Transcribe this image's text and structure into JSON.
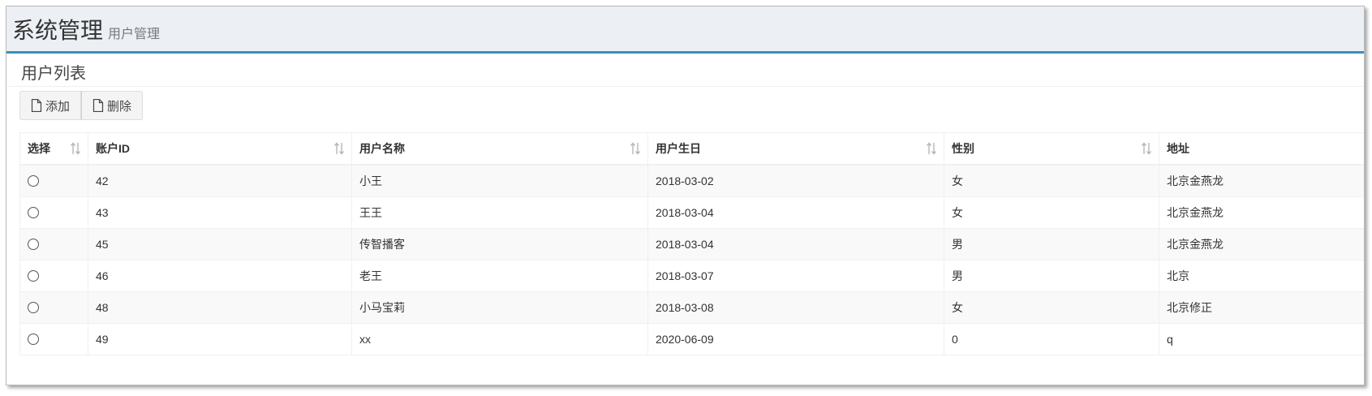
{
  "header": {
    "title": "系统管理",
    "subtitle": "用户管理"
  },
  "box": {
    "title": "用户列表"
  },
  "toolbar": {
    "add_label": "添加",
    "delete_label": "删除"
  },
  "table": {
    "columns": [
      "选择",
      "账户ID",
      "用户名称",
      "用户生日",
      "性别",
      "地址"
    ],
    "rows": [
      {
        "id": "42",
        "name": "小王",
        "birthday": "2018-03-02",
        "sex": "女",
        "address": "北京金燕龙"
      },
      {
        "id": "43",
        "name": "王王",
        "birthday": "2018-03-04",
        "sex": "女",
        "address": "北京金燕龙"
      },
      {
        "id": "45",
        "name": "传智播客",
        "birthday": "2018-03-04",
        "sex": "男",
        "address": "北京金燕龙"
      },
      {
        "id": "46",
        "name": "老王",
        "birthday": "2018-03-07",
        "sex": "男",
        "address": "北京"
      },
      {
        "id": "48",
        "name": "小马宝莉",
        "birthday": "2018-03-08",
        "sex": "女",
        "address": "北京修正"
      },
      {
        "id": "49",
        "name": "xx",
        "birthday": "2020-06-09",
        "sex": "0",
        "address": "q"
      }
    ]
  },
  "colors": {
    "accent": "#3c8dbc",
    "header_bg": "#ecf0f5"
  },
  "icons": {
    "toolbar": "file-icon",
    "sort": "sort-icon"
  }
}
